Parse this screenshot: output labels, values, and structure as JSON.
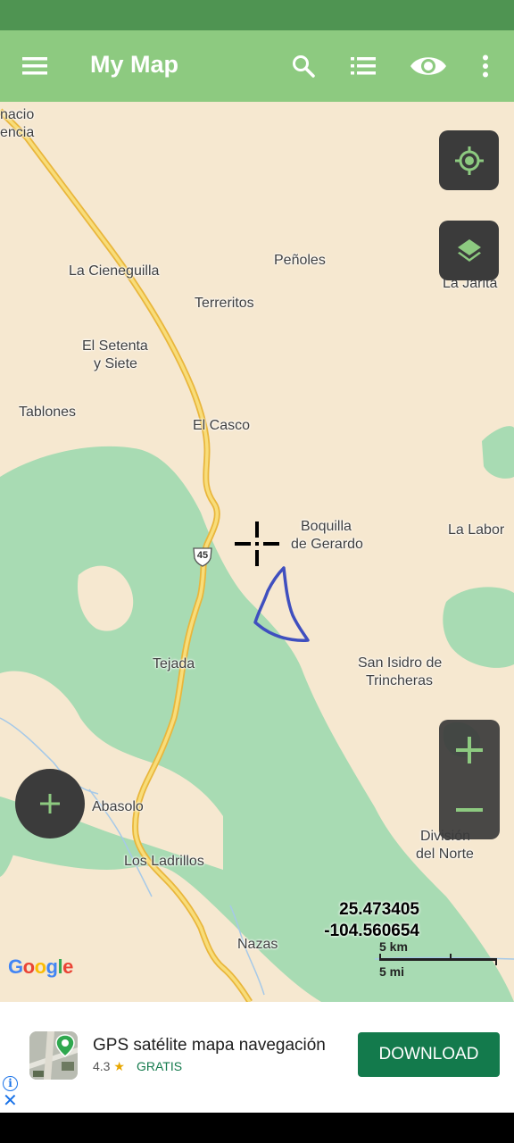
{
  "colors": {
    "status_bar": "#4f9452",
    "toolbar": "#8dca80",
    "map_land": "#f6e8d0",
    "map_forest": "#a8dbb3",
    "highway": "#f0c84a",
    "drawn_polygon": "#3f4fbf",
    "ad_button": "#137a4c"
  },
  "toolbar": {
    "title": "My Map",
    "icons": [
      "menu-icon",
      "search-icon",
      "list-icon",
      "eye-icon",
      "more-vert-icon"
    ]
  },
  "map": {
    "places": [
      "nacio",
      "encia",
      "La Cieneguilla",
      "Peñoles",
      "La Jarita",
      "Terreritos",
      "El Setenta",
      "y Siete",
      "Tablones",
      "El Casco",
      "Boquilla",
      "de Gerardo",
      "La Labor",
      "Tejada",
      "San Isidro de",
      "Trincheras",
      "Abasolo",
      "División",
      "del Norte",
      "Los Ladrillos",
      "Nazas"
    ],
    "highway_shield": "45",
    "crosshair": "crosshair-icon",
    "coordinates": {
      "lat": "25.473405",
      "lng": "-104.560654"
    },
    "scale": {
      "km_label": "5 km",
      "mi_label": "5 mi"
    },
    "attribution": "Google",
    "buttons": {
      "my_location": "my-location-icon",
      "layers": "layers-icon",
      "add": "+",
      "zoom_in": "+",
      "zoom_out": "−"
    }
  },
  "ad": {
    "app_name": "GPS satélite mapa navegación",
    "rating": "4.3",
    "star": "★",
    "price": "GRATIS",
    "cta": "DOWNLOAD",
    "info_glyph": "i",
    "close_glyph": "✕"
  }
}
